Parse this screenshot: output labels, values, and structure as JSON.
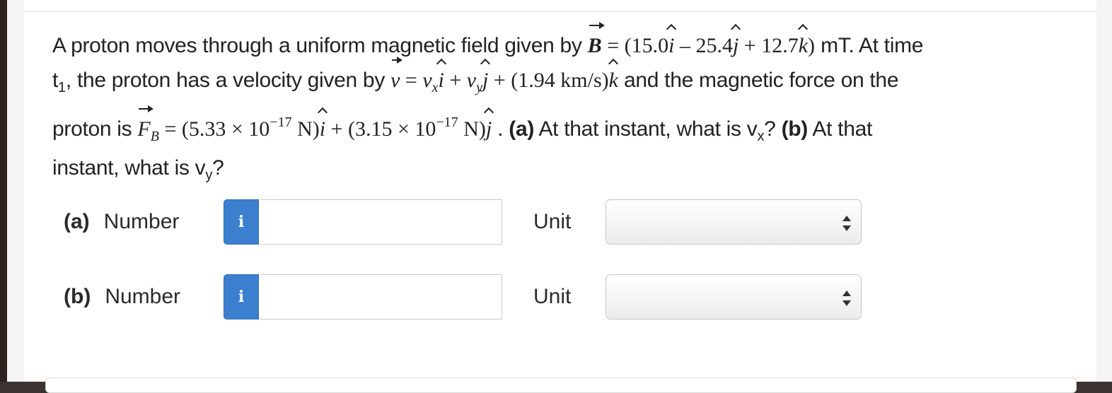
{
  "question": {
    "l1_a": "A proton moves through a uniform magnetic field given by ",
    "B_sym": "B",
    "eq": " = ",
    "B_open": "(15.0",
    "B_mid1": " – 25.4",
    "B_mid2": " + 12.7",
    "B_close": ")",
    "l1_b": " mT. At time",
    "t_sym": "t",
    "t_sub": "1",
    "l2_a": ", the proton has a velocity given by ",
    "v_sym": "v",
    "eq2": " = ",
    "vx_sym": "v",
    "vx_sub": "x",
    "plus1": " + ",
    "vy_sym": "v",
    "vy_sub": "y",
    "v_tail": " + (1.94 km/s)",
    "l2_b": " and the magnetic force on the",
    "l3_a": "proton is ",
    "F_sym": "F",
    "F_sub": "B",
    "eq3": " = ",
    "F1_open": "(5.33 × 10",
    "exp1": "−17",
    "F1_close": " N)",
    "F2_open": " + (3.15 × 10",
    "exp2": "−17",
    "F2_close": " N)",
    "l3_b": " . ",
    "part_a_tag": "(a)",
    "part_a_text": " At that instant, what is v",
    "part_a_sub": "x",
    "part_a_q": "? ",
    "part_b_tag": "(b)",
    "part_b_text": " At that",
    "l4_a": "instant, what is v",
    "l4_sub": "y",
    "l4_q": "?",
    "unit_i": "i",
    "unit_j": "j",
    "unit_k": "k"
  },
  "answers": [
    {
      "part": "(a)",
      "label": "Number",
      "info_icon": "i",
      "value": "",
      "unit_label": "Unit",
      "unit_selected": ""
    },
    {
      "part": "(b)",
      "label": "Number",
      "info_icon": "i",
      "value": "",
      "unit_label": "Unit",
      "unit_selected": ""
    }
  ]
}
